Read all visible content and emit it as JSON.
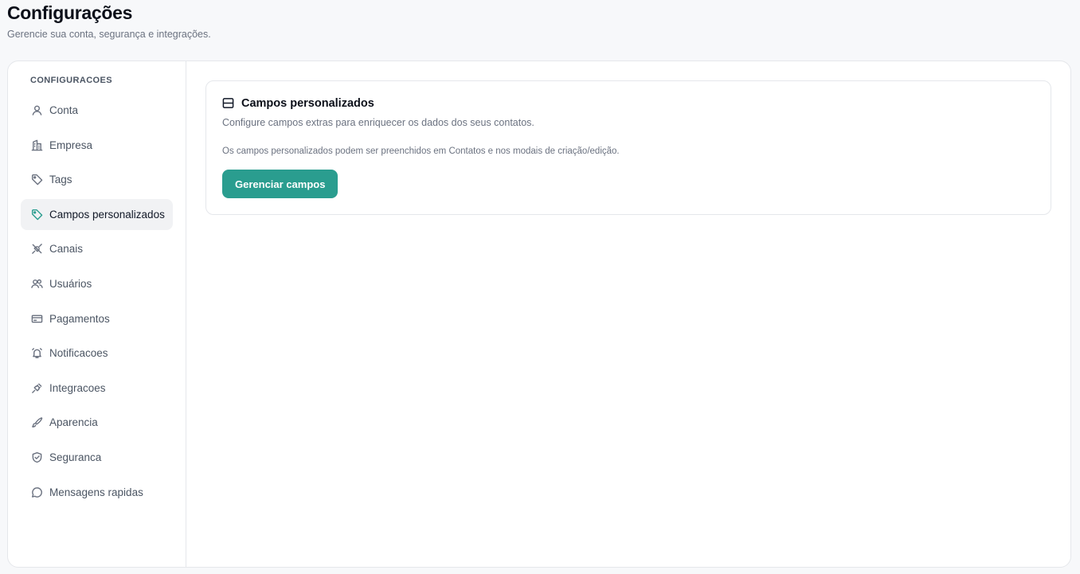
{
  "header": {
    "title": "Configurações",
    "subtitle": "Gerencie sua conta, segurança e integrações."
  },
  "sidebar": {
    "heading": "CONFIGURACOES",
    "items": [
      {
        "label": "Conta",
        "icon": "user-icon",
        "active": false
      },
      {
        "label": "Empresa",
        "icon": "building-icon",
        "active": false
      },
      {
        "label": "Tags",
        "icon": "tag-icon",
        "active": false
      },
      {
        "label": "Campos personalizados",
        "icon": "tag-icon",
        "active": true
      },
      {
        "label": "Canais",
        "icon": "plug-icon",
        "active": false
      },
      {
        "label": "Usuários",
        "icon": "users-icon",
        "active": false
      },
      {
        "label": "Pagamentos",
        "icon": "credit-card-icon",
        "active": false
      },
      {
        "label": "Notificacoes",
        "icon": "alarm-icon",
        "active": false
      },
      {
        "label": "Integracoes",
        "icon": "plug-icon",
        "active": false
      },
      {
        "label": "Aparencia",
        "icon": "brush-icon",
        "active": false
      },
      {
        "label": "Seguranca",
        "icon": "shield-icon",
        "active": false
      },
      {
        "label": "Mensagens rapidas",
        "icon": "chat-bubble-icon",
        "active": false
      }
    ]
  },
  "main": {
    "card": {
      "icon": "columns-icon",
      "title": "Campos personalizados",
      "description": "Configure campos extras para enriquecer os dados dos seus contatos.",
      "note": "Os campos personalizados podem ser preenchidos em Contatos e nos modais de criação/edição.",
      "button_label": "Gerenciar campos"
    }
  },
  "colors": {
    "accent": "#2a9d8f",
    "active_bg": "#f1f2f4",
    "border": "#e5e7eb"
  }
}
